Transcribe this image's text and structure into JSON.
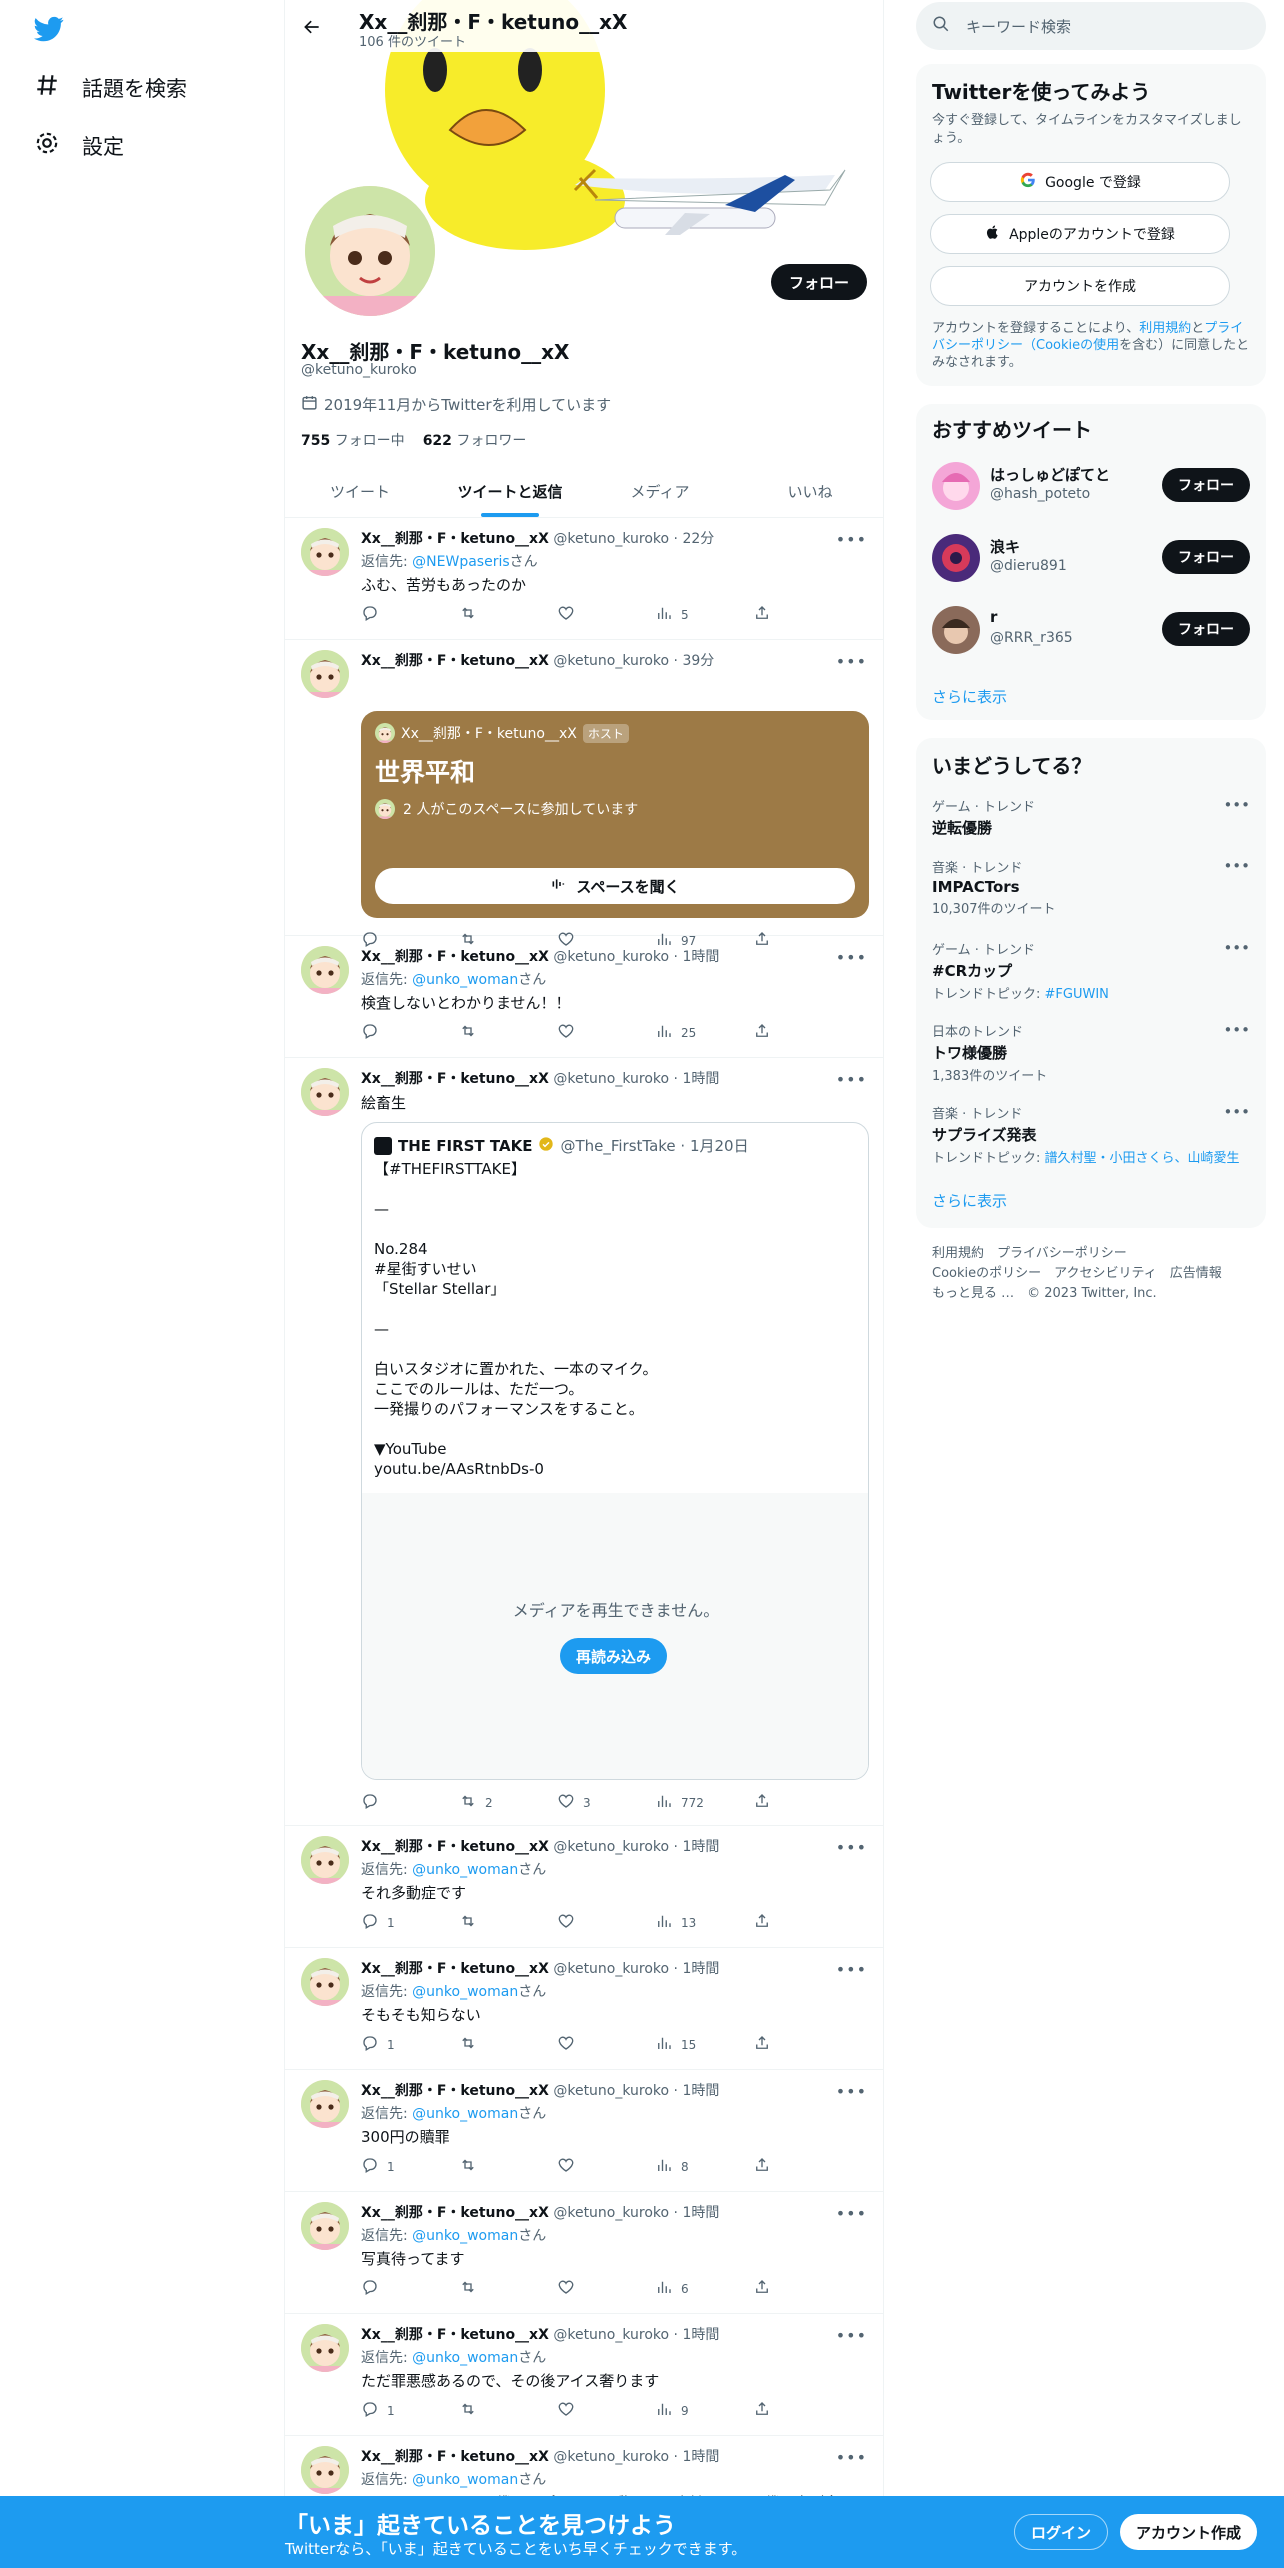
{
  "nav": {
    "items": [
      {
        "label": "話題を検索",
        "icon": "hashtag-icon"
      },
      {
        "label": "設定",
        "icon": "gear-icon"
      }
    ]
  },
  "header": {
    "title": "Xx__刹那・F・ketuno__xX",
    "subtitle": "106 件のツイート"
  },
  "profile": {
    "name": "Xx__刹那・F・ketuno__xX",
    "handle": "@ketuno_kuroko",
    "joined": "2019年11月からTwitterを利用しています",
    "following_count": "755",
    "following_label": "フォロー中",
    "followers_count": "622",
    "followers_label": "フォロワー",
    "follow_label": "フォロー"
  },
  "tabs": [
    "ツイート",
    "ツイートと返信",
    "メディア",
    "いいね"
  ],
  "tweets": [
    {
      "name": "Xx__刹那・F・ketuno__xX",
      "meta": "@ketuno_kuroko · 22分",
      "reply_prefix": "返信先: ",
      "reply_to": "@NEWpaseris",
      "reply_suffix": "さん",
      "text": "ふむ、苦労もあったのか",
      "replies": "",
      "retweets": "",
      "likes": "",
      "views": "5"
    },
    {
      "name": "Xx__刹那・F・ketuno__xX",
      "meta": "@ketuno_kuroko · 39分",
      "views": "97",
      "space": {
        "host": "Xx__刹那・F・ketuno__xX",
        "host_badge": "ホスト",
        "title": "世界平和",
        "participants": "2 人がこのスペースに参加しています",
        "listen": "スペースを聞く"
      }
    },
    {
      "name": "Xx__刹那・F・ketuno__xX",
      "meta": "@ketuno_kuroko · 1時間",
      "reply_prefix": "返信先: ",
      "reply_to": "@unko_woman",
      "reply_suffix": "さん",
      "text": "検査しないとわかりません！！",
      "views": "25"
    },
    {
      "name": "Xx__刹那・F・ketuno__xX",
      "meta": "@ketuno_kuroko · 1時間",
      "text": "絵畜生",
      "retweets": "2",
      "likes": "3",
      "views": "772",
      "quote": {
        "name": "THE FIRST TAKE",
        "meta": "@The_FirstTake · 1月20日",
        "lines": [
          "【#THEFIRSTTAKE】",
          "",
          "—",
          "",
          "No.284",
          "#星街すいせい",
          "「Stellar Stellar」",
          "",
          "—",
          "",
          "白いスタジオに置かれた、一本のマイク。",
          "ここでのルールは、ただ一つ。",
          "一発撮りのパフォーマンスをすること。",
          "",
          "▼YouTube",
          "youtu.be/AAsRtnbDs-0"
        ],
        "media_error": "メディアを再生できません。",
        "reload": "再読み込み"
      }
    },
    {
      "name": "Xx__刹那・F・ketuno__xX",
      "meta": "@ketuno_kuroko · 1時間",
      "reply_prefix": "返信先: ",
      "reply_to": "@unko_woman",
      "reply_suffix": "さん",
      "text": "それ多動症です",
      "replies": "1",
      "views": "13"
    },
    {
      "name": "Xx__刹那・F・ketuno__xX",
      "meta": "@ketuno_kuroko · 1時間",
      "reply_prefix": "返信先: ",
      "reply_to": "@unko_woman",
      "reply_suffix": "さん",
      "text": "そもそも知らない",
      "replies": "1",
      "views": "15"
    },
    {
      "name": "Xx__刹那・F・ketuno__xX",
      "meta": "@ketuno_kuroko · 1時間",
      "reply_prefix": "返信先: ",
      "reply_to": "@unko_woman",
      "reply_suffix": "さん",
      "text": "300円の贖罪",
      "replies": "1",
      "views": "8"
    },
    {
      "name": "Xx__刹那・F・ketuno__xX",
      "meta": "@ketuno_kuroko · 1時間",
      "reply_prefix": "返信先: ",
      "reply_to": "@unko_woman",
      "reply_suffix": "さん",
      "text": "写真待ってます",
      "views": "6"
    },
    {
      "name": "Xx__刹那・F・ketuno__xX",
      "meta": "@ketuno_kuroko · 1時間",
      "reply_prefix": "返信先: ",
      "reply_to": "@unko_woman",
      "reply_suffix": "さん",
      "text": "ただ罪悪感あるので、その後アイス奢ります",
      "replies": "1",
      "views": "9"
    },
    {
      "name": "Xx__刹那・F・ketuno__xX",
      "meta": "@ketuno_kuroko · 1時間",
      "reply_prefix": "返信先: ",
      "reply_to": "@unko_woman",
      "reply_suffix": "さん",
      "text": "ちなみに、あなたに僕は一ぱすかな運動して、会計明らかに僕の方が多く"
    }
  ],
  "search": {
    "placeholder": "キーワード検索"
  },
  "join": {
    "title": "Twitterを使ってみよう",
    "desc": "今すぐ登録して、タイムラインをカスタマイズしましょう。",
    "google": "Google で登録",
    "apple": "Appleのアカウントで登録",
    "create": "アカウントを作成",
    "terms_1": "アカウントを登録することにより、",
    "terms_link1": "利用規約",
    "terms_2": "と",
    "terms_link2": "プライバシーポリシー（Cookieの使用",
    "terms_3": "を含む）に同意したとみなされます。"
  },
  "recommend": {
    "title": "おすすめツイート",
    "users": [
      {
        "name": "はっしゅどぽてと",
        "handle": "@hash_poteto",
        "btn": "フォロー"
      },
      {
        "name": "浪キ",
        "handle": "@dieru891",
        "btn": "フォロー"
      },
      {
        "name": "r",
        "handle": "@RRR_r365",
        "btn": "フォロー"
      }
    ],
    "more": "さらに表示"
  },
  "trends": {
    "title": "いまどうしてる？",
    "items": [
      {
        "cat": "ゲーム · トレンド",
        "name": "逆転優勝",
        "extra": ""
      },
      {
        "cat": "音楽 · トレンド",
        "name": "IMPACTors",
        "extra": "10,307件のツイート"
      },
      {
        "cat": "ゲーム · トレンド",
        "name": "#CRカップ",
        "extra_prefix": "トレンドトピック: ",
        "extra_link": "#FGUWIN"
      },
      {
        "cat": "日本のトレンド",
        "name": "トワ様優勝",
        "extra": "1,383件のツイート"
      },
      {
        "cat": "音楽 · トレンド",
        "name": "サプライズ発表",
        "extra_prefix": "トレンドトピック: ",
        "extra_link": "譜久村聖・小田さくら、山崎愛生"
      }
    ],
    "more": "さらに表示"
  },
  "footer": {
    "line1": "利用規約　プライバシーポリシー",
    "line2": "Cookieのポリシー　アクセシビリティ　広告情報",
    "line3": "もっと見る …　© 2023 Twitter, Inc."
  },
  "bottom": {
    "title": "「いま」起きていることを見つけよう",
    "sub": "Twitterなら、「いま」起きていることをいち早くチェックできます。",
    "login": "ログイン",
    "signup": "アカウント作成"
  },
  "colors": {
    "accent": "#1d9bf0",
    "space_card": "#9d7a46",
    "dark": "#0f1419"
  }
}
